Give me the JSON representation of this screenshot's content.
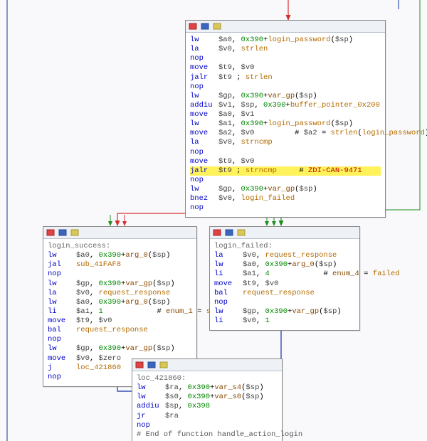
{
  "colors": {
    "true_edge": "#1e8f1e",
    "false_edge": "#d43030",
    "flow_edge": "#1030a0"
  },
  "titlebar": {
    "icons": [
      {
        "name": "breakpoint-icon",
        "fill": "#d44"
      },
      {
        "name": "toggle-icon",
        "fill": "#3a66c2"
      },
      {
        "name": "collapse-icon",
        "fill": "#b8a23a"
      }
    ]
  },
  "nodes": {
    "top": {
      "label": "",
      "lines": [
        {
          "mn": "lw",
          "args": [
            [
              "reg",
              "$a0"
            ],
            [
              "txt",
              ", "
            ],
            [
              "num",
              "0x390"
            ],
            [
              "txt",
              "+"
            ],
            [
              "sym",
              "login_password"
            ],
            [
              "txt",
              "("
            ],
            [
              "reg",
              "$sp"
            ],
            [
              "txt",
              ")"
            ]
          ]
        },
        {
          "mn": "la",
          "args": [
            [
              "reg",
              "$v0"
            ],
            [
              "txt",
              ", "
            ],
            [
              "sym",
              "strlen"
            ]
          ]
        },
        {
          "mn": "nop",
          "args": []
        },
        {
          "mn": "move",
          "args": [
            [
              "reg",
              "$t9"
            ],
            [
              "txt",
              ", "
            ],
            [
              "reg",
              "$v0"
            ]
          ]
        },
        {
          "mn": "jalr",
          "args": [
            [
              "reg",
              "$t9"
            ],
            [
              "txt",
              " ; "
            ],
            [
              "sym",
              "strlen"
            ]
          ]
        },
        {
          "mn": "nop",
          "args": []
        },
        {
          "mn": "lw",
          "args": [
            [
              "reg",
              "$gp"
            ],
            [
              "txt",
              ", "
            ],
            [
              "num",
              "0x390"
            ],
            [
              "txt",
              "+"
            ],
            [
              "kw",
              "var_gp"
            ],
            [
              "txt",
              "("
            ],
            [
              "reg",
              "$sp"
            ],
            [
              "txt",
              ")"
            ]
          ]
        },
        {
          "mn": "addiu",
          "args": [
            [
              "reg",
              "$v1"
            ],
            [
              "txt",
              ", "
            ],
            [
              "reg",
              "$sp"
            ],
            [
              "txt",
              ", "
            ],
            [
              "num",
              "0x390"
            ],
            [
              "txt",
              "+"
            ],
            [
              "sym",
              "buffer_pointer_0x200"
            ]
          ]
        },
        {
          "mn": "move",
          "args": [
            [
              "reg",
              "$a0"
            ],
            [
              "txt",
              ", "
            ],
            [
              "reg",
              "$v1"
            ]
          ]
        },
        {
          "mn": "lw",
          "args": [
            [
              "reg",
              "$a1"
            ],
            [
              "txt",
              ", "
            ],
            [
              "num",
              "0x390"
            ],
            [
              "txt",
              "+"
            ],
            [
              "sym",
              "login_password"
            ],
            [
              "txt",
              "("
            ],
            [
              "reg",
              "$sp"
            ],
            [
              "txt",
              ")"
            ]
          ]
        },
        {
          "mn": "move",
          "args": [
            [
              "reg",
              "$a2"
            ],
            [
              "txt",
              ", "
            ],
            [
              "reg",
              "$v0"
            ],
            [
              "txt",
              "         # "
            ],
            [
              "reg",
              "$a2"
            ],
            [
              "txt",
              " = "
            ],
            [
              "sym",
              "strlen"
            ],
            [
              "txt",
              "("
            ],
            [
              "sym",
              "login_password"
            ],
            [
              "txt",
              ")"
            ]
          ]
        },
        {
          "mn": "la",
          "args": [
            [
              "reg",
              "$v0"
            ],
            [
              "txt",
              ", "
            ],
            [
              "sym",
              "strncmp"
            ]
          ]
        },
        {
          "mn": "nop",
          "args": []
        },
        {
          "mn": "move",
          "args": [
            [
              "reg",
              "$t9"
            ],
            [
              "txt",
              ", "
            ],
            [
              "reg",
              "$v0"
            ]
          ]
        },
        {
          "mn": "jalr",
          "hl": true,
          "args": [
            [
              "reg",
              "$t9"
            ],
            [
              "txt",
              " ; "
            ],
            [
              "sym",
              "strncmp"
            ],
            [
              "txt",
              "     # "
            ],
            [
              "zdi",
              "ZDI-CAN-9471"
            ]
          ]
        },
        {
          "mn": "nop",
          "args": []
        },
        {
          "mn": "lw",
          "args": [
            [
              "reg",
              "$gp"
            ],
            [
              "txt",
              ", "
            ],
            [
              "num",
              "0x390"
            ],
            [
              "txt",
              "+"
            ],
            [
              "kw",
              "var_gp"
            ],
            [
              "txt",
              "("
            ],
            [
              "reg",
              "$sp"
            ],
            [
              "txt",
              ")"
            ]
          ]
        },
        {
          "mn": "bnez",
          "args": [
            [
              "reg",
              "$v0"
            ],
            [
              "txt",
              ", "
            ],
            [
              "sym",
              "login_failed"
            ]
          ]
        },
        {
          "mn": "nop",
          "args": []
        }
      ]
    },
    "left": {
      "label": "login_success:",
      "lines": [
        {
          "mn": "lw",
          "args": [
            [
              "reg",
              "$a0"
            ],
            [
              "txt",
              ", "
            ],
            [
              "num",
              "0x390"
            ],
            [
              "txt",
              "+"
            ],
            [
              "kw",
              "arg_0"
            ],
            [
              "txt",
              "("
            ],
            [
              "reg",
              "$sp"
            ],
            [
              "txt",
              ")"
            ]
          ]
        },
        {
          "mn": "jal",
          "args": [
            [
              "sym",
              "sub_41FAF8"
            ]
          ]
        },
        {
          "mn": "nop",
          "args": []
        },
        {
          "mn": "lw",
          "args": [
            [
              "reg",
              "$gp"
            ],
            [
              "txt",
              ", "
            ],
            [
              "num",
              "0x390"
            ],
            [
              "txt",
              "+"
            ],
            [
              "kw",
              "var_gp"
            ],
            [
              "txt",
              "("
            ],
            [
              "reg",
              "$sp"
            ],
            [
              "txt",
              ")"
            ]
          ]
        },
        {
          "mn": "la",
          "args": [
            [
              "reg",
              "$v0"
            ],
            [
              "txt",
              ", "
            ],
            [
              "sym",
              "request_response"
            ]
          ]
        },
        {
          "mn": "lw",
          "args": [
            [
              "reg",
              "$a0"
            ],
            [
              "txt",
              ", "
            ],
            [
              "num",
              "0x390"
            ],
            [
              "txt",
              "+"
            ],
            [
              "kw",
              "arg_0"
            ],
            [
              "txt",
              "("
            ],
            [
              "reg",
              "$sp"
            ],
            [
              "txt",
              ")"
            ]
          ]
        },
        {
          "mn": "li",
          "args": [
            [
              "reg",
              "$a1"
            ],
            [
              "txt",
              ", "
            ],
            [
              "num",
              "1"
            ],
            [
              "txt",
              "            # "
            ],
            [
              "kw",
              "enum_1"
            ],
            [
              "txt",
              " = "
            ],
            [
              "sym",
              "success"
            ]
          ]
        },
        {
          "mn": "move",
          "args": [
            [
              "reg",
              "$t9"
            ],
            [
              "txt",
              ", "
            ],
            [
              "reg",
              "$v0"
            ]
          ]
        },
        {
          "mn": "bal",
          "args": [
            [
              "sym",
              "request_response"
            ]
          ]
        },
        {
          "mn": "nop",
          "args": []
        },
        {
          "mn": "lw",
          "args": [
            [
              "reg",
              "$gp"
            ],
            [
              "txt",
              ", "
            ],
            [
              "num",
              "0x390"
            ],
            [
              "txt",
              "+"
            ],
            [
              "kw",
              "var_gp"
            ],
            [
              "txt",
              "("
            ],
            [
              "reg",
              "$sp"
            ],
            [
              "txt",
              ")"
            ]
          ]
        },
        {
          "mn": "move",
          "args": [
            [
              "reg",
              "$v0"
            ],
            [
              "txt",
              ", "
            ],
            [
              "reg",
              "$zero"
            ]
          ]
        },
        {
          "mn": "j",
          "args": [
            [
              "sym",
              "loc_421860"
            ]
          ]
        },
        {
          "mn": "nop",
          "args": []
        }
      ]
    },
    "right": {
      "label": "login_failed:",
      "lines": [
        {
          "mn": "la",
          "args": [
            [
              "reg",
              "$v0"
            ],
            [
              "txt",
              ", "
            ],
            [
              "sym",
              "request_response"
            ]
          ]
        },
        {
          "mn": "lw",
          "args": [
            [
              "reg",
              "$a0"
            ],
            [
              "txt",
              ", "
            ],
            [
              "num",
              "0x390"
            ],
            [
              "txt",
              "+"
            ],
            [
              "kw",
              "arg_0"
            ],
            [
              "txt",
              "("
            ],
            [
              "reg",
              "$sp"
            ],
            [
              "txt",
              ")"
            ]
          ]
        },
        {
          "mn": "li",
          "args": [
            [
              "reg",
              "$a1"
            ],
            [
              "txt",
              ", "
            ],
            [
              "num",
              "4"
            ],
            [
              "txt",
              "            # "
            ],
            [
              "kw",
              "enum_4"
            ],
            [
              "txt",
              " = "
            ],
            [
              "sym",
              "failed"
            ]
          ]
        },
        {
          "mn": "move",
          "args": [
            [
              "reg",
              "$t9"
            ],
            [
              "txt",
              ", "
            ],
            [
              "reg",
              "$v0"
            ]
          ]
        },
        {
          "mn": "bal",
          "args": [
            [
              "sym",
              "request_response"
            ]
          ]
        },
        {
          "mn": "nop",
          "args": []
        },
        {
          "mn": "lw",
          "args": [
            [
              "reg",
              "$gp"
            ],
            [
              "txt",
              ", "
            ],
            [
              "num",
              "0x390"
            ],
            [
              "txt",
              "+"
            ],
            [
              "kw",
              "var_gp"
            ],
            [
              "txt",
              "("
            ],
            [
              "reg",
              "$sp"
            ],
            [
              "txt",
              ")"
            ]
          ]
        },
        {
          "mn": "li",
          "args": [
            [
              "reg",
              "$v0"
            ],
            [
              "txt",
              ", "
            ],
            [
              "num",
              "1"
            ]
          ]
        }
      ]
    },
    "bottom": {
      "label": "loc_421860:",
      "lines": [
        {
          "mn": "lw",
          "args": [
            [
              "reg",
              "$ra"
            ],
            [
              "txt",
              ", "
            ],
            [
              "num",
              "0x390"
            ],
            [
              "txt",
              "+"
            ],
            [
              "kw",
              "var_s4"
            ],
            [
              "txt",
              "("
            ],
            [
              "reg",
              "$sp"
            ],
            [
              "txt",
              ")"
            ]
          ]
        },
        {
          "mn": "lw",
          "args": [
            [
              "reg",
              "$s0"
            ],
            [
              "txt",
              ", "
            ],
            [
              "num",
              "0x390"
            ],
            [
              "txt",
              "+"
            ],
            [
              "kw",
              "var_s0"
            ],
            [
              "txt",
              "("
            ],
            [
              "reg",
              "$sp"
            ],
            [
              "txt",
              ")"
            ]
          ]
        },
        {
          "mn": "addiu",
          "args": [
            [
              "reg",
              "$sp"
            ],
            [
              "txt",
              ", "
            ],
            [
              "num",
              "0x398"
            ]
          ]
        },
        {
          "mn": "jr",
          "args": [
            [
              "reg",
              "$ra"
            ]
          ]
        },
        {
          "mn": "nop",
          "args": []
        },
        {
          "mn": "",
          "args": [
            [
              "cmt",
              "# End of function handle_action_login"
            ]
          ]
        }
      ]
    }
  }
}
